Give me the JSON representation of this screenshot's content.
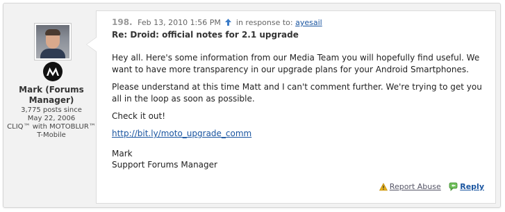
{
  "author": {
    "name_line1": "Mark (Forums",
    "name_line2": "Manager)",
    "posts_line1": "3,775 posts since",
    "posts_line2": "May 22, 2006",
    "device_line1": "CLIQ™ with MOTOBLUR™",
    "device_line2": "T-Mobile",
    "avatar_icon": "person-avatar",
    "badge_icon": "motorola-logo"
  },
  "post": {
    "number": "198.",
    "date": "Feb 13, 2010 1:56 PM",
    "in_response_to": "in response to:",
    "respondee": "ayesail",
    "subject": "Re: Droid: official notes for 2.1 upgrade",
    "paragraph1": "Hey all.  Here's some information from our Media Team you will hopefully find useful. We want to have more transparency in our upgrade plans for your Android Smartphones.",
    "paragraph2": "Please understand at this time Matt and I can't comment further. We're trying to get you all in the loop as soon as possible.",
    "paragraph3": "Check it out!",
    "link": "http://bit.ly/moto_upgrade_comm",
    "signature_name": "Mark",
    "signature_title": "Support Forums Manager"
  },
  "actions": {
    "report": "Report Abuse",
    "reply": "Reply"
  },
  "colors": {
    "link": "#1a55a0",
    "panel_bg": "#f2f2f2",
    "bubble_bg": "#ffffff",
    "warn": "#e8b21a",
    "reply_icon": "#4a9b3a",
    "up_arrow": "#3a7bc8"
  }
}
